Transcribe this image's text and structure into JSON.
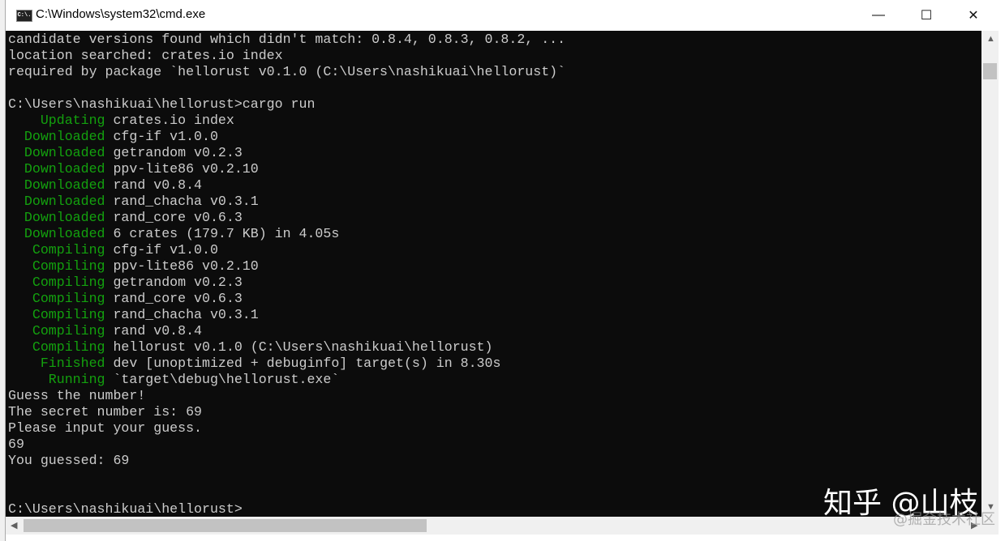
{
  "window": {
    "title": "C:\\Windows\\system32\\cmd.exe",
    "icon": "cmd-icon",
    "icon_text": "C:\\."
  },
  "controls": {
    "minimize": "—",
    "maximize": "☐",
    "close": "✕"
  },
  "colors": {
    "background": "#0c0c0c",
    "text": "#cccccc",
    "green": "#13a10e"
  },
  "lines": [
    [
      "",
      "candidate versions found which didn't match: 0.8.4, 0.8.3, 0.8.2, ..."
    ],
    [
      "",
      "location searched: crates.io index"
    ],
    [
      "",
      "required by package `hellorust v0.1.0 (C:\\Users\\nashikuai\\hellorust)`"
    ],
    [
      "",
      ""
    ],
    [
      "",
      "C:\\Users\\nashikuai\\hellorust>cargo run"
    ],
    [
      "    Updating",
      " crates.io index"
    ],
    [
      "  Downloaded",
      " cfg-if v1.0.0"
    ],
    [
      "  Downloaded",
      " getrandom v0.2.3"
    ],
    [
      "  Downloaded",
      " ppv-lite86 v0.2.10"
    ],
    [
      "  Downloaded",
      " rand v0.8.4"
    ],
    [
      "  Downloaded",
      " rand_chacha v0.3.1"
    ],
    [
      "  Downloaded",
      " rand_core v0.6.3"
    ],
    [
      "  Downloaded",
      " 6 crates (179.7 KB) in 4.05s"
    ],
    [
      "   Compiling",
      " cfg-if v1.0.0"
    ],
    [
      "   Compiling",
      " ppv-lite86 v0.2.10"
    ],
    [
      "   Compiling",
      " getrandom v0.2.3"
    ],
    [
      "   Compiling",
      " rand_core v0.6.3"
    ],
    [
      "   Compiling",
      " rand_chacha v0.3.1"
    ],
    [
      "   Compiling",
      " rand v0.8.4"
    ],
    [
      "   Compiling",
      " hellorust v0.1.0 (C:\\Users\\nashikuai\\hellorust)"
    ],
    [
      "    Finished",
      " dev [unoptimized + debuginfo] target(s) in 8.30s"
    ],
    [
      "     Running",
      " `target\\debug\\hellorust.exe`"
    ],
    [
      "",
      "Guess the number!"
    ],
    [
      "",
      "The secret number is: 69"
    ],
    [
      "",
      "Please input your guess."
    ],
    [
      "",
      "69"
    ],
    [
      "",
      "You guessed: 69"
    ],
    [
      "",
      ""
    ],
    [
      "",
      ""
    ],
    [
      "",
      "C:\\Users\\nashikuai\\hellorust>"
    ]
  ],
  "watermark": {
    "main": "知乎 @山枝",
    "secondary": "@掘金技术社区"
  }
}
